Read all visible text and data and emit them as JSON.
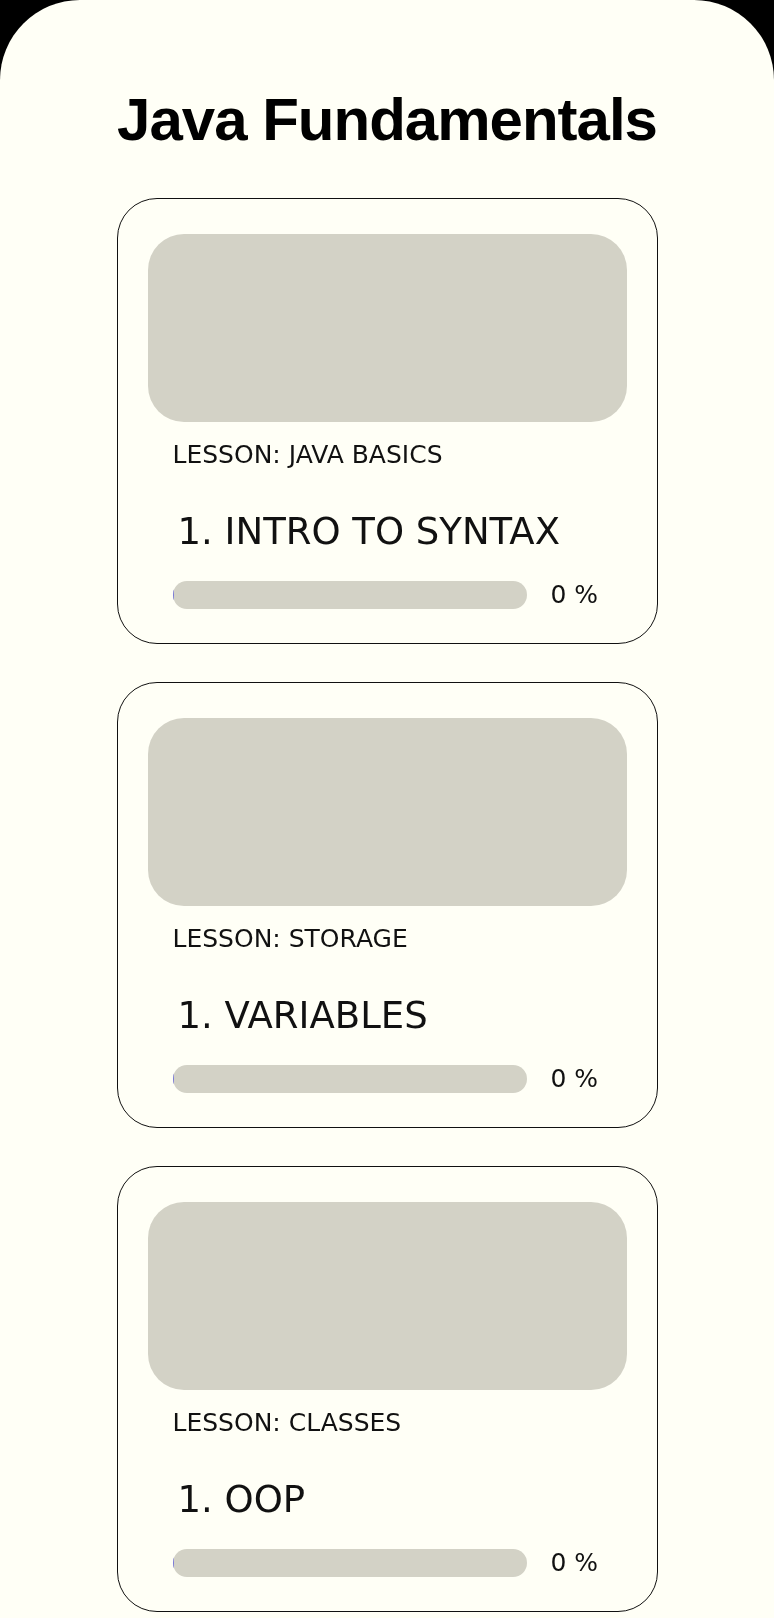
{
  "title": "Java Fundamentals",
  "lessons": [
    {
      "lesson": "LESSON: JAVA BASICS",
      "item": "1. INTRO TO SYNTAX",
      "level": 0,
      "reading": "0 %"
    },
    {
      "lesson": "LESSON: STORAGE",
      "item": "1. VARIABLES",
      "level": 0,
      "reading": "0 %"
    },
    {
      "lesson": "LESSON: CLASSES",
      "item": "1. OOP",
      "level": 0,
      "reading": "0 %"
    }
  ]
}
